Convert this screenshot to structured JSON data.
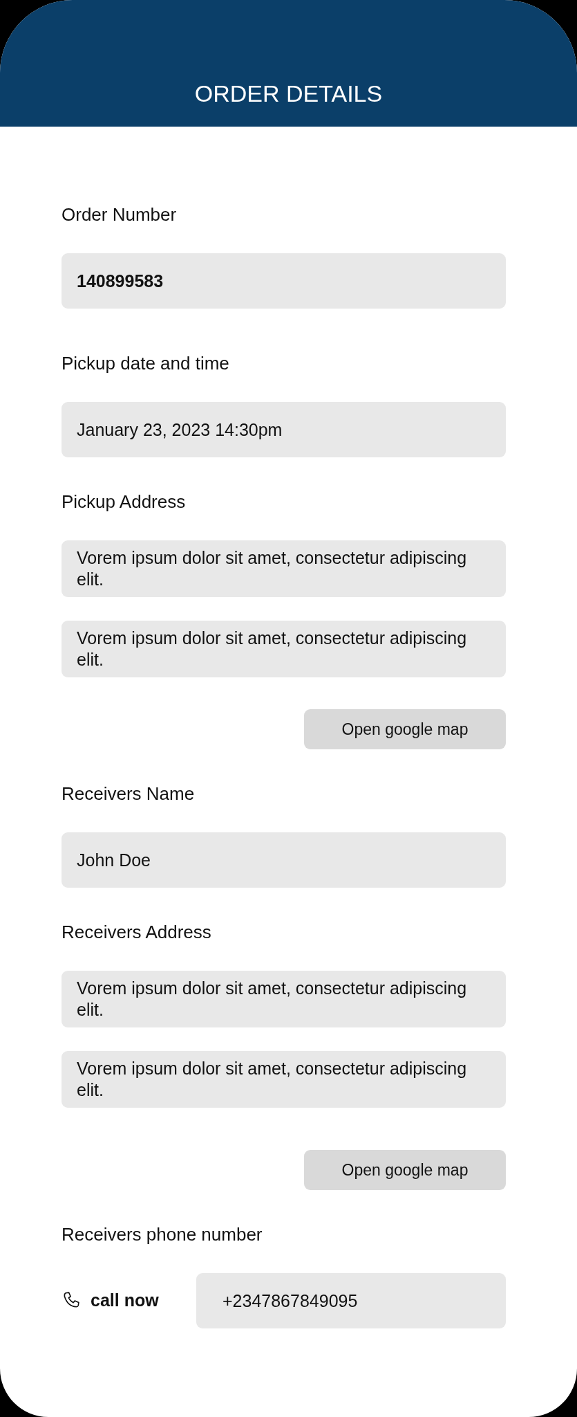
{
  "header": {
    "title": "ORDER DETAILS"
  },
  "sections": [
    {
      "label": "Order Number",
      "fields": [
        {
          "value": "140899583",
          "bold": true
        }
      ]
    },
    {
      "label": "Pickup date and time",
      "fields": [
        {
          "value": "January 23, 2023 14:30pm",
          "bold": false
        }
      ]
    },
    {
      "label": "Pickup Address",
      "fields": [
        {
          "value": "Vorem ipsum dolor sit amet, consectetur adipiscing elit.",
          "bold": false
        },
        {
          "value": "Vorem ipsum dolor sit amet, consectetur adipiscing elit.",
          "bold": false
        }
      ],
      "button": "Open google map"
    },
    {
      "label": "Receivers Name",
      "fields": [
        {
          "value": "John Doe",
          "bold": false
        }
      ]
    },
    {
      "label": "Receivers Address",
      "fields": [
        {
          "value": "Vorem ipsum dolor sit amet, consectetur adipiscing elit.",
          "bold": false
        },
        {
          "value": "Vorem ipsum dolor sit amet, consectetur adipiscing elit.",
          "bold": false
        }
      ],
      "button": "Open google map"
    },
    {
      "label": "Receivers phone number",
      "call_button": "call now",
      "fields": [
        {
          "value": "+2347867849095",
          "bold": false
        }
      ]
    }
  ]
}
